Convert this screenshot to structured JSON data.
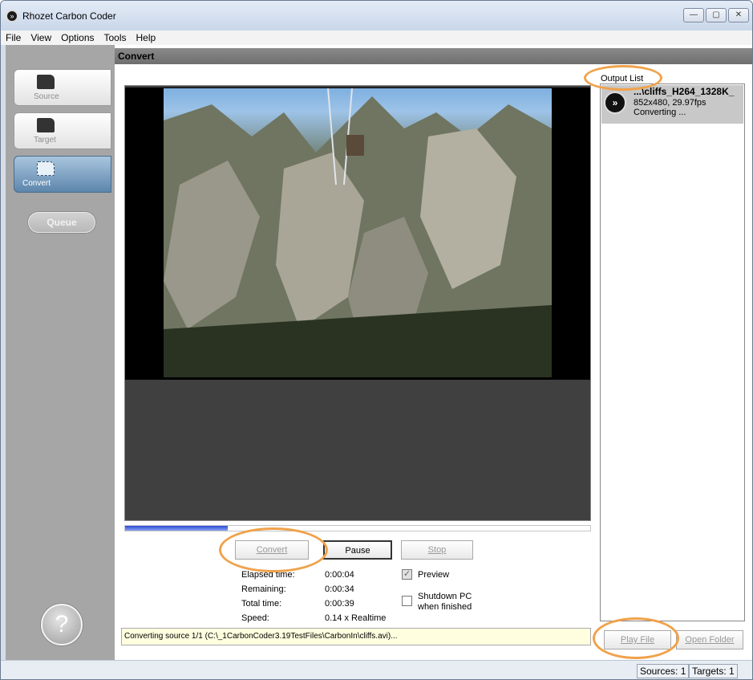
{
  "window": {
    "title": "Rhozet Carbon Coder",
    "minimize": "—",
    "maximize": "▢",
    "close": "✕"
  },
  "menu": [
    "File",
    "View",
    "Options",
    "Tools",
    "Help"
  ],
  "sidebar": {
    "tabs": [
      {
        "label": "Source",
        "icon": "folder-icon",
        "active": false
      },
      {
        "label": "Target",
        "icon": "target-folder-icon",
        "active": false
      },
      {
        "label": "Convert",
        "icon": "convert-icon",
        "active": true
      }
    ],
    "queue_label": "Queue",
    "help_label": "?"
  },
  "main": {
    "header": "Convert",
    "progress_fraction": 0.22,
    "buttons": {
      "convert": "Convert",
      "pause": "Pause",
      "stop": "Stop"
    },
    "stats": [
      {
        "label": "Elapsed time:",
        "value": "0:00:04"
      },
      {
        "label": "Remaining:",
        "value": "0:00:34"
      },
      {
        "label": "Total time:",
        "value": "0:00:39"
      },
      {
        "label": "Speed:",
        "value": "0.14 x Realtime"
      }
    ],
    "preview_label": "Preview",
    "preview_checked": true,
    "shutdown_label_1": "Shutdown PC",
    "shutdown_label_2": "when finished",
    "shutdown_checked": false,
    "status": "Converting source 1/1 (C:\\_1CarbonCoder3.19TestFiles\\CarbonIn\\cliffs.avi)..."
  },
  "output": {
    "label": "Output List",
    "item": {
      "title": "...\\cliffs_H264_1328K_",
      "line1": "852x480, 29.97fps",
      "line2": "Converting ..."
    },
    "play_file": "Play File",
    "open_folder": "Open Folder"
  },
  "statusbar": {
    "sources": "Sources: 1",
    "targets": "Targets: 1"
  },
  "colors": {
    "highlight_ring": "#f0a24b",
    "progress": "#2a4cd6",
    "status_bg": "#ffffe0"
  }
}
